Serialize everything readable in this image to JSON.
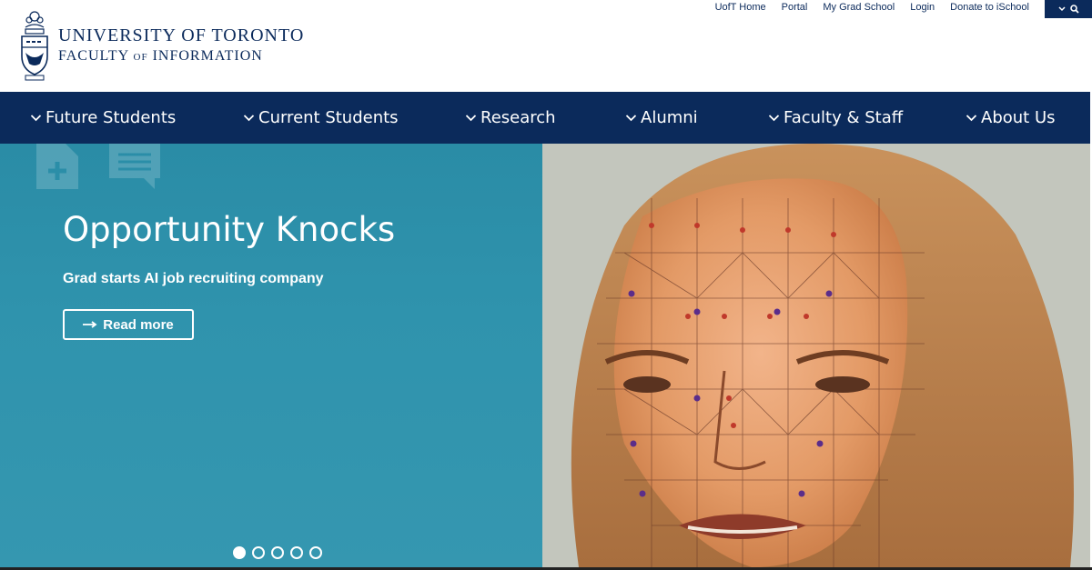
{
  "header": {
    "logo": {
      "line1": "UNIVERSITY OF TORONTO",
      "line2_a": "FACULTY",
      "line2_of": "OF",
      "line2_b": "INFORMATION"
    },
    "utility_links": [
      "UofT Home",
      "Portal",
      "My Grad School",
      "Login",
      "Donate to iSchool"
    ],
    "search_toggle": {
      "icons": [
        "chevron-down-icon",
        "search-icon"
      ]
    }
  },
  "nav": {
    "items": [
      {
        "label": "Future Students"
      },
      {
        "label": "Current Students"
      },
      {
        "label": "Research"
      },
      {
        "label": "Alumni"
      },
      {
        "label": "Faculty & Staff"
      },
      {
        "label": "About Us"
      }
    ]
  },
  "hero": {
    "title": "Opportunity Knocks",
    "subtitle": "Grad starts AI job recruiting company",
    "button_label": "Read more",
    "slides_total": 5,
    "active_slide": 1,
    "image": "woman-face-with-facial-recognition-mesh",
    "colors": {
      "panel": "#2f93ad",
      "nav": "#0b2a5b"
    }
  }
}
